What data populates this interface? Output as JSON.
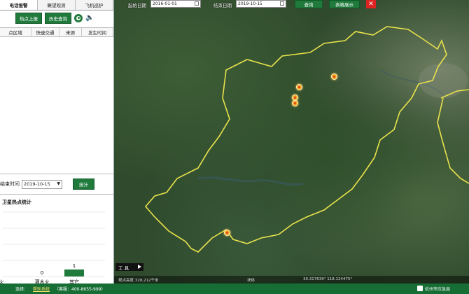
{
  "tabs": [
    {
      "label": "电话报警"
    },
    {
      "label": "瞭望观测"
    },
    {
      "label": "飞机巡护"
    }
  ],
  "hotspot_panel": {
    "report_button": "热点上报",
    "history_button": "历史查询",
    "columns": [
      "点区域",
      "快速交通",
      "来源",
      "发生时间"
    ]
  },
  "statistics": {
    "end_time_label": "结束时间",
    "end_date": "2019-10-15",
    "stat_button": "统计"
  },
  "chart_data": {
    "type": "bar",
    "title": "卫星热点统计",
    "categories": [
      "火",
      "灌木火",
      "其它"
    ],
    "values": [
      0,
      0,
      1
    ],
    "value_labels": [
      "",
      "0",
      "1"
    ],
    "bar_color": "#1f7a3c"
  },
  "toolbar": {
    "start_label": "起始日期",
    "start_date": "2016-01-01",
    "end_label": "结束日期",
    "end_date": "2019-10-15",
    "query_button": "查询",
    "table_button": "表格展示"
  },
  "map": {
    "tools_label": "工 具",
    "coords": {
      "left": "视点高度 328,212千米",
      "center": "块体",
      "right": "30.317639° 118.124475°"
    }
  },
  "footer": {
    "choose_label": "选择：",
    "link": "帮助系统",
    "hotline": "（客服：400-8655-999）",
    "org": "杭州市应急局"
  },
  "colors": {
    "brand_green": "#1f7a3c",
    "boundary": "#e9e24c",
    "close_red": "#dd2222"
  }
}
